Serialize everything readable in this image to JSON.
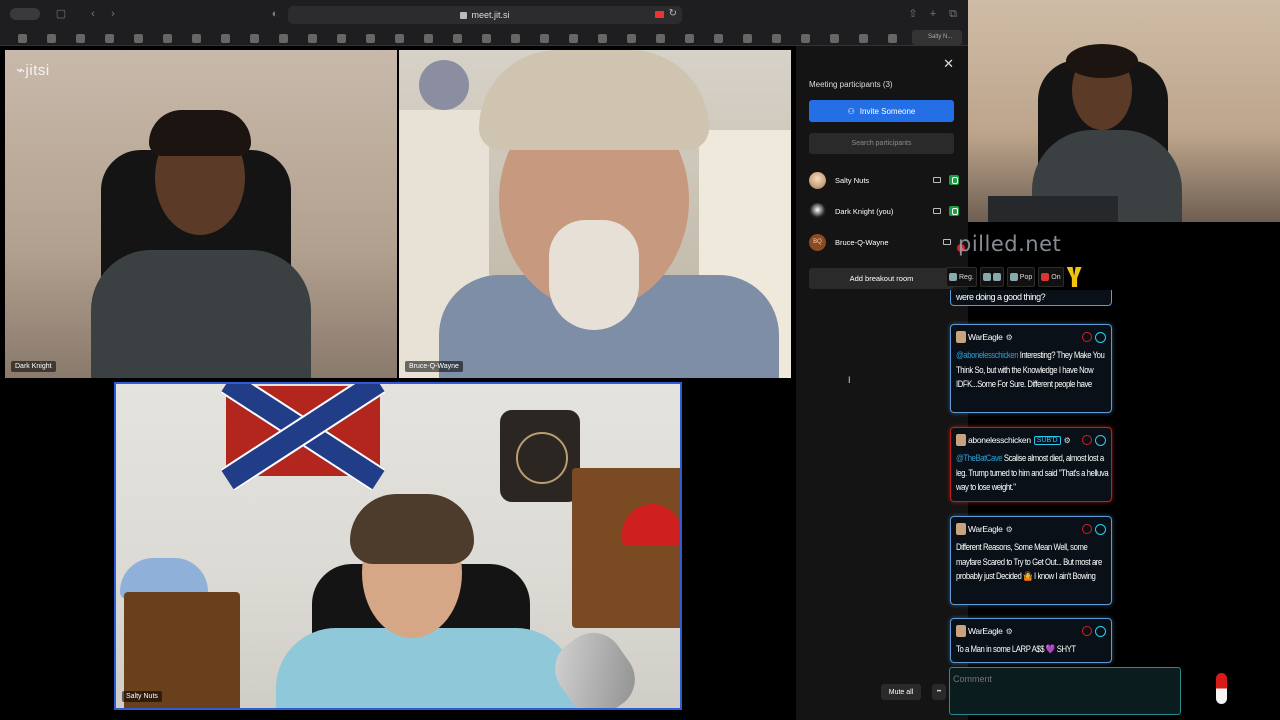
{
  "browser": {
    "url": "meet.jit.si",
    "active_tab_label": "Salty N..."
  },
  "app": {
    "logo_text": "jitsi"
  },
  "tiles": {
    "dark_knight": "Dark Knight",
    "bruce": "Bruce-Q-Wayne",
    "salty": "Salty Nuts"
  },
  "panel": {
    "title": "Meeting participants (3)",
    "invite_label": "Invite Someone",
    "search_placeholder": "Search participants",
    "participants": [
      {
        "name": "Salty Nuts",
        "initials": ""
      },
      {
        "name": "Dark Knight (you)",
        "initials": ""
      },
      {
        "name": "Bruce-Q-Wayne",
        "initials": "BQ"
      }
    ],
    "breakout_label": "Add breakout room",
    "mute_all_label": "Mute all",
    "more_label": "••"
  },
  "chat": {
    "brand": "pilled.net",
    "toolbar": [
      "Reg.",
      "",
      "Pop",
      "On"
    ],
    "partial_text": "were doing a good thing?",
    "messages": [
      {
        "user": "WarEagle",
        "sub": "",
        "mention": "@abonelesschicken",
        "text": " Interesting? They Make You Think So, but with the Knowledge I have Now IDFK...Some For Sure. Different people have",
        "highlight": false
      },
      {
        "user": "abonelesschicken",
        "sub": "SUB'D",
        "mention": "@TheBatCave",
        "text": " Scalise almost died, almost lost a leg. Trump turned to him and said \"That's a helluva way to lose weight.\"",
        "highlight": true
      },
      {
        "user": "WarEagle",
        "sub": "",
        "mention": "",
        "text": "Different Reasons, Some Mean Well, some mayfare Scared to Try to Get Out... But most are probably just Decided 🤷 I know I ain't Bowing",
        "highlight": false
      },
      {
        "user": "WarEagle",
        "sub": "",
        "mention": "",
        "text": "To a Man in some LARP A$$ 💜 SHYT",
        "highlight": false
      }
    ],
    "comment_placeholder": "Comment"
  },
  "colors": {
    "accent_blue": "#246fe5",
    "active_speaker": "#2f5bd6",
    "mic_on": "#1f9c45",
    "chat_border": "#5e9bd6",
    "chat_highlight": "#c21c1c"
  }
}
